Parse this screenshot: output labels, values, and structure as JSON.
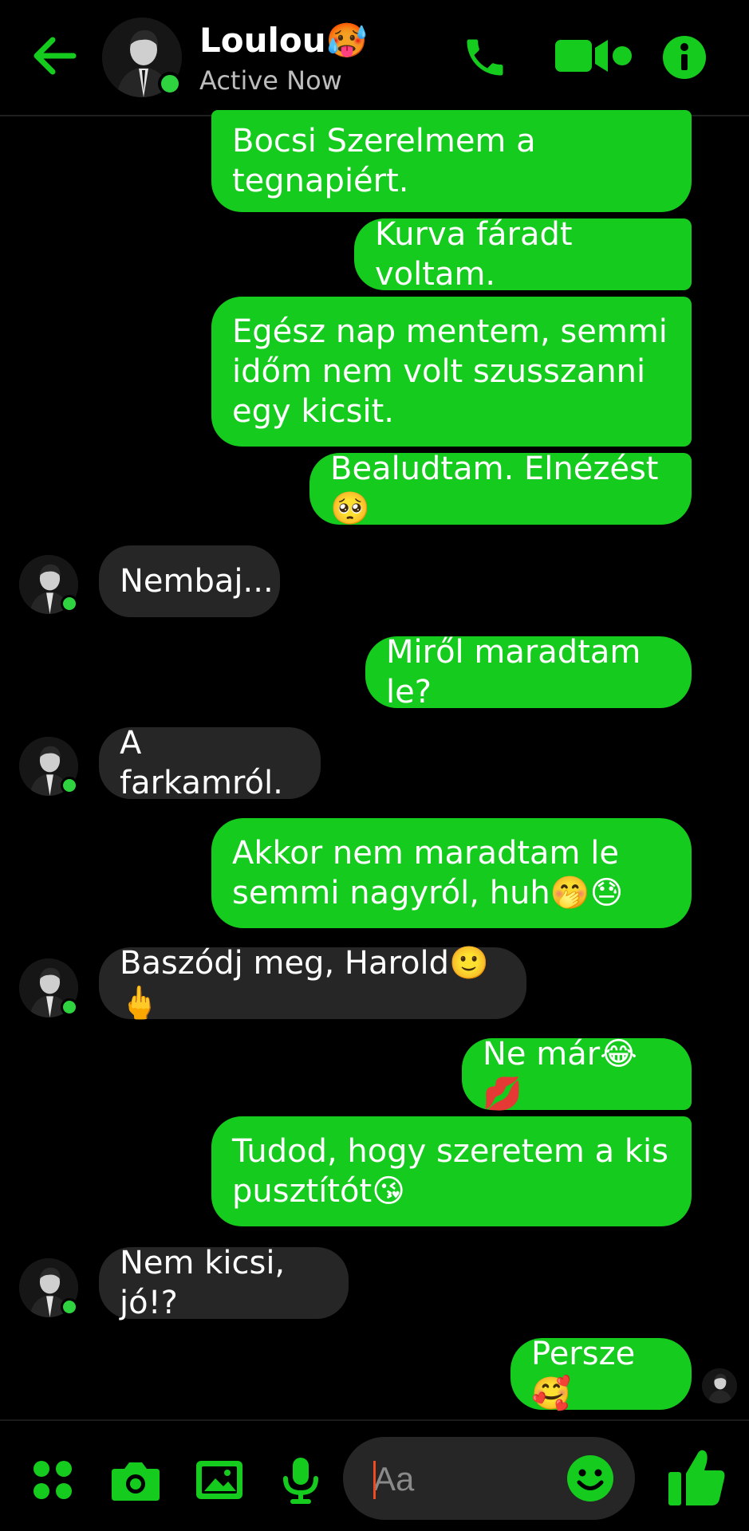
{
  "header": {
    "contact_name": "Loulou🥵",
    "status": "Active Now",
    "icons": {
      "back": "arrow-left-icon",
      "call": "phone-icon",
      "video": "video-camera-icon",
      "info": "info-icon"
    }
  },
  "messages": [
    {
      "direction": "out",
      "text": "Bocsi Szerelmem a\ntegnapiért."
    },
    {
      "direction": "out",
      "text": "Kurva fáradt voltam."
    },
    {
      "direction": "out",
      "text": "Egész nap mentem, semmi\nidőm nem volt szusszanni\negy kicsit."
    },
    {
      "direction": "out",
      "text": "Bealudtam. Elnézést🥺"
    },
    {
      "direction": "in",
      "text": "Nembaj..."
    },
    {
      "direction": "out",
      "text": "Miről maradtam le?"
    },
    {
      "direction": "in",
      "text": "A farkamról."
    },
    {
      "direction": "out",
      "text": "Akkor nem maradtam le\nsemmi nagyról, huh🤭😓"
    },
    {
      "direction": "in",
      "text": "Baszódj meg, Harold🙂🖕"
    },
    {
      "direction": "out",
      "text": "Ne már😂💋"
    },
    {
      "direction": "out",
      "text": "Tudod, hogy szeretem a kis\npusztítót😘"
    },
    {
      "direction": "in",
      "text": "Nem kicsi, jó!?"
    },
    {
      "direction": "out",
      "text": "Persze🥰"
    }
  ],
  "composer": {
    "placeholder": "Aa",
    "icons": {
      "menu": "four-dots-menu-icon",
      "camera": "camera-icon",
      "gallery": "image-icon",
      "mic": "microphone-icon",
      "emoji": "smiley-icon",
      "like": "thumbs-up-icon"
    }
  },
  "colors": {
    "accent": "#15cb1d",
    "outgoing_bubble": "#15cb1d",
    "incoming_bubble": "#262626",
    "background": "#000000",
    "online": "#2ed33f",
    "caret": "#f04a23"
  }
}
